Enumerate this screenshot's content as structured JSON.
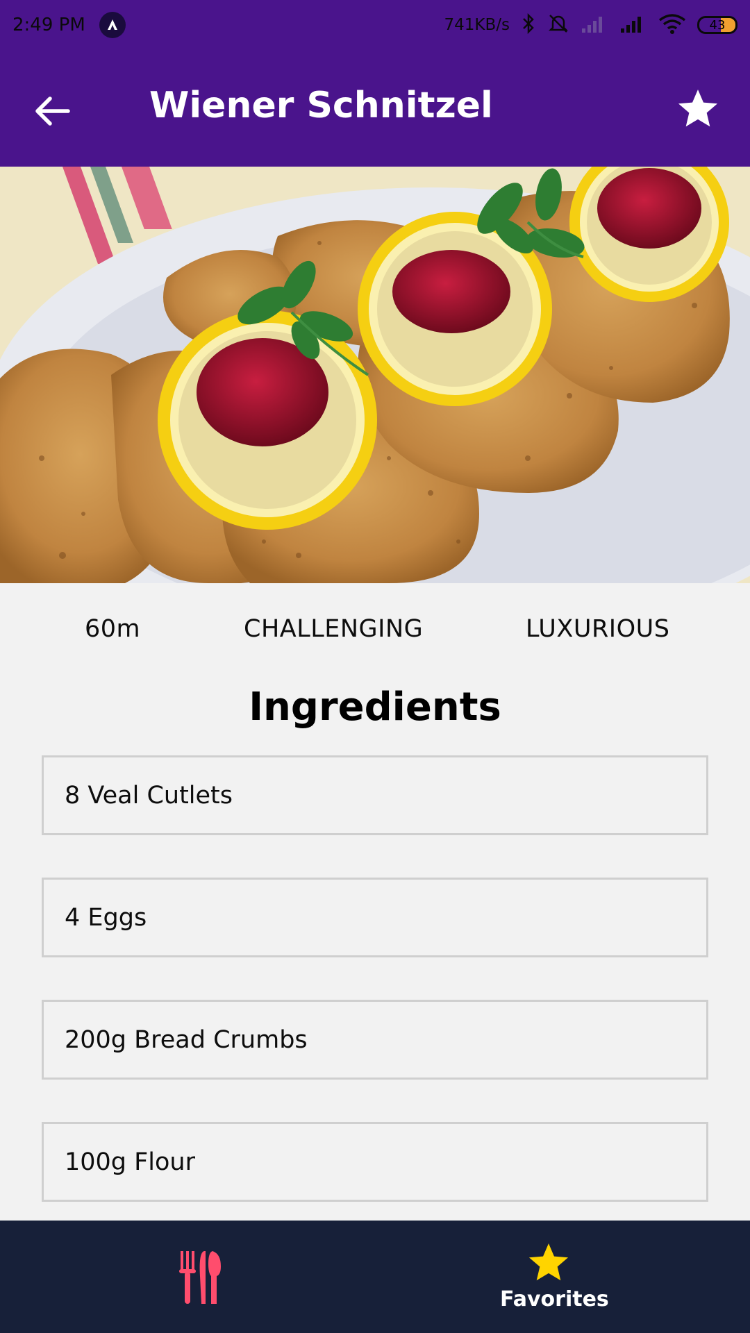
{
  "colors": {
    "primary": "#4a148c",
    "nav_bg": "#172039",
    "accent": "#ffd400",
    "inactive_icon": "#ff4d6d"
  },
  "status_bar": {
    "time": "2:49 PM",
    "net_speed": "741KB/s",
    "battery": "43"
  },
  "app_bar": {
    "title": "Wiener Schnitzel",
    "back_icon": "arrow-left-icon",
    "favorite_icon": "star-icon"
  },
  "hero": {
    "image_subject": "schnitzel-with-lemon-and-jam"
  },
  "meta": {
    "duration": "60m",
    "complexity": "CHALLENGING",
    "affordability": "LUXURIOUS"
  },
  "ingredients": {
    "title": "Ingredients",
    "items": [
      "8 Veal Cutlets",
      "4 Eggs",
      "200g Bread Crumbs",
      "100g Flour"
    ]
  },
  "bottom_nav": {
    "categories_icon": "restaurant-icon",
    "favorites_label": "Favorites",
    "favorites_icon": "star-icon"
  }
}
